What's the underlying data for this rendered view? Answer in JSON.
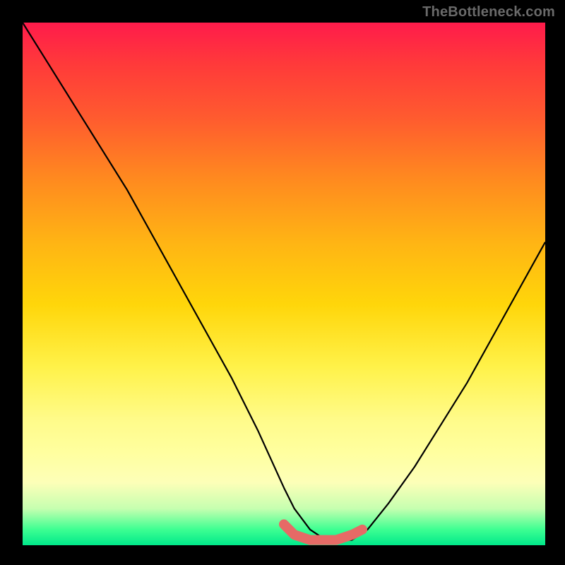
{
  "watermark": "TheBottleneck.com",
  "chart_data": {
    "type": "line",
    "title": "",
    "xlabel": "",
    "ylabel": "",
    "xlim": [
      0,
      100
    ],
    "ylim": [
      0,
      100
    ],
    "grid": false,
    "legend": false,
    "series": [
      {
        "name": "black-curve",
        "color": "#000000",
        "x": [
          0,
          5,
          10,
          15,
          20,
          25,
          30,
          35,
          40,
          45,
          50,
          52,
          55,
          58,
          60,
          63,
          66,
          70,
          75,
          80,
          85,
          90,
          95,
          100
        ],
        "values": [
          100,
          92,
          84,
          76,
          68,
          59,
          50,
          41,
          32,
          22,
          11,
          7,
          3,
          1,
          1,
          1,
          3,
          8,
          15,
          23,
          31,
          40,
          49,
          58
        ]
      },
      {
        "name": "red-thick-segment",
        "color": "#e66a66",
        "x": [
          50,
          52,
          55,
          58,
          60,
          63,
          65
        ],
        "values": [
          4,
          2,
          1,
          1,
          1,
          2,
          3
        ]
      }
    ]
  }
}
